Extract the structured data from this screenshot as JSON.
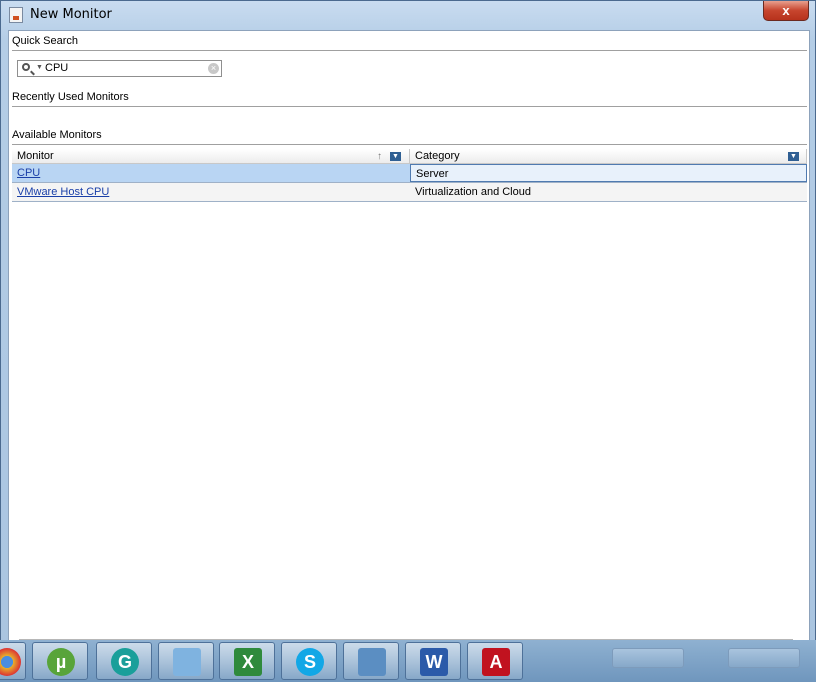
{
  "window": {
    "title": "New Monitor",
    "close_label": "x"
  },
  "quick_search": {
    "label": "Quick Search",
    "value": "CPU"
  },
  "recently_used": {
    "label": "Recently Used Monitors"
  },
  "available": {
    "label": "Available Monitors",
    "columns": [
      "Monitor",
      "Category"
    ],
    "rows": [
      {
        "monitor": "CPU",
        "category": "Server"
      },
      {
        "monitor": "VMware Host CPU",
        "category": "Virtualization and Cloud"
      }
    ]
  },
  "taskbar": {
    "apps": [
      "chrome-icon",
      "utorrent-icon",
      "grammarly-icon",
      "notepad-icon",
      "excel-icon",
      "skype-icon",
      "monitor-app-icon",
      "word-icon",
      "acrobat-icon"
    ]
  },
  "colors": {
    "selected_row": "#b9d5f3",
    "link": "#1a3fa8",
    "close_button": "#c7452e"
  }
}
